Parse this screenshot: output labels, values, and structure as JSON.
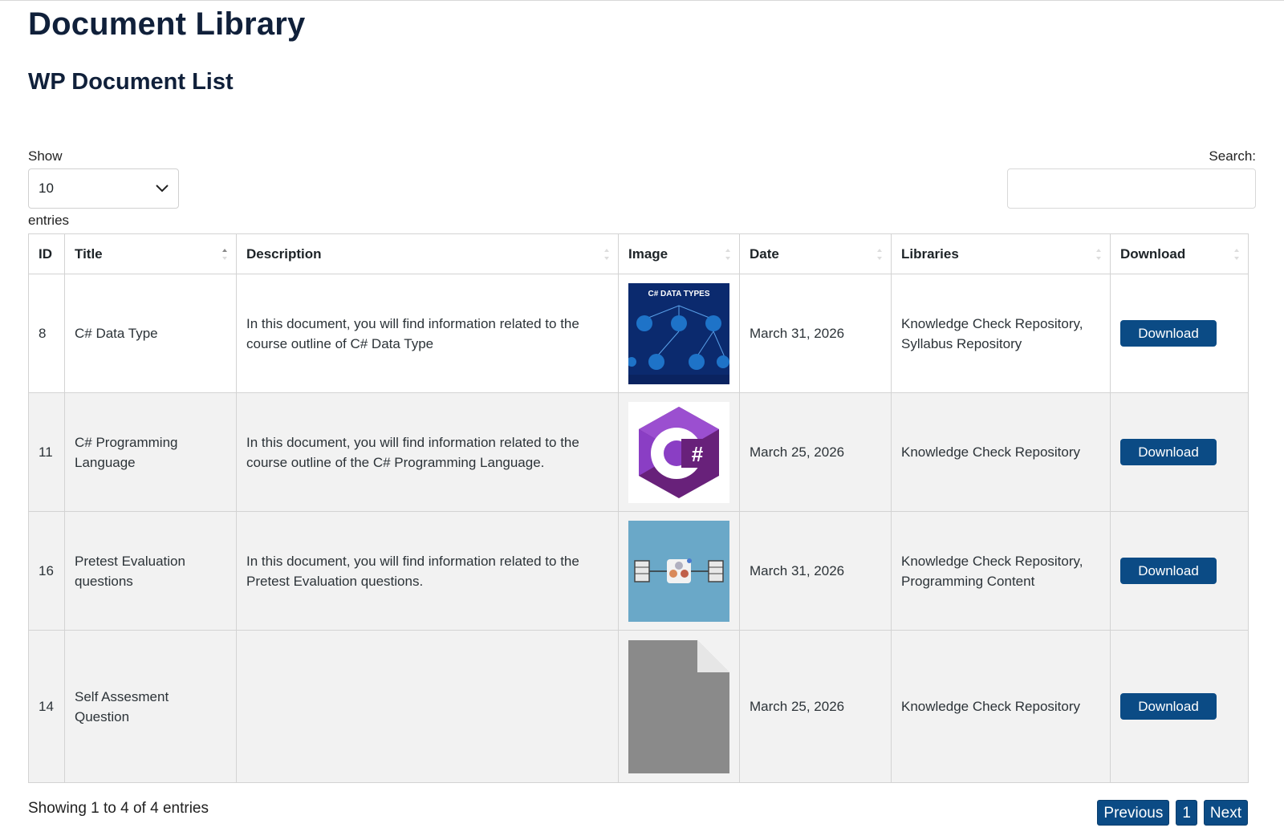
{
  "page": {
    "title": "Document Library",
    "subtitle": "WP Document List"
  },
  "controls": {
    "show_label": "Show",
    "page_size": "10",
    "entries_label": "entries",
    "search_label": "Search:",
    "search_value": ""
  },
  "table": {
    "columns": [
      "ID",
      "Title",
      "Description",
      "Image",
      "Date",
      "Libraries",
      "Download"
    ],
    "rows": [
      {
        "id": "8",
        "title": "C# Data Type",
        "description": "In this document, you will find information related to the course outline of C# Data Type",
        "image": "csharp-data-types-thumbnail",
        "date": "March 31, 2026",
        "libraries": "Knowledge Check Repository, Syllabus Repository",
        "download": "Download"
      },
      {
        "id": "11",
        "title": "C# Programming Language",
        "description": "In this document, you will find information related to the course outline of the C# Programming Language.",
        "image": "csharp-logo-thumbnail",
        "date": "March 25, 2026",
        "libraries": "Knowledge Check Repository",
        "download": "Download"
      },
      {
        "id": "16",
        "title": "Pretest Evaluation questions",
        "description": "In this document, you will find information related to the Pretest Evaluation questions.",
        "image": "pretest-diagram-thumbnail",
        "date": "March 31, 2026",
        "libraries": "Knowledge Check Repository, Programming Content",
        "download": "Download"
      },
      {
        "id": "14",
        "title": "Self Assesment Question",
        "description": "",
        "image": "generic-file-icon",
        "date": "March 25, 2026",
        "libraries": "Knowledge Check Repository",
        "download": "Download"
      }
    ],
    "thumb_text": {
      "csharp_data_types": "C# DATA TYPES",
      "csharp_logo": "#"
    }
  },
  "footer": {
    "info": "Showing 1 to 4 of 4 entries",
    "prev": "Previous",
    "page": "1",
    "next": "Next"
  },
  "colors": {
    "accent": "#0b4b85",
    "heading": "#10203a",
    "row_alt": "#f2f2f2"
  }
}
